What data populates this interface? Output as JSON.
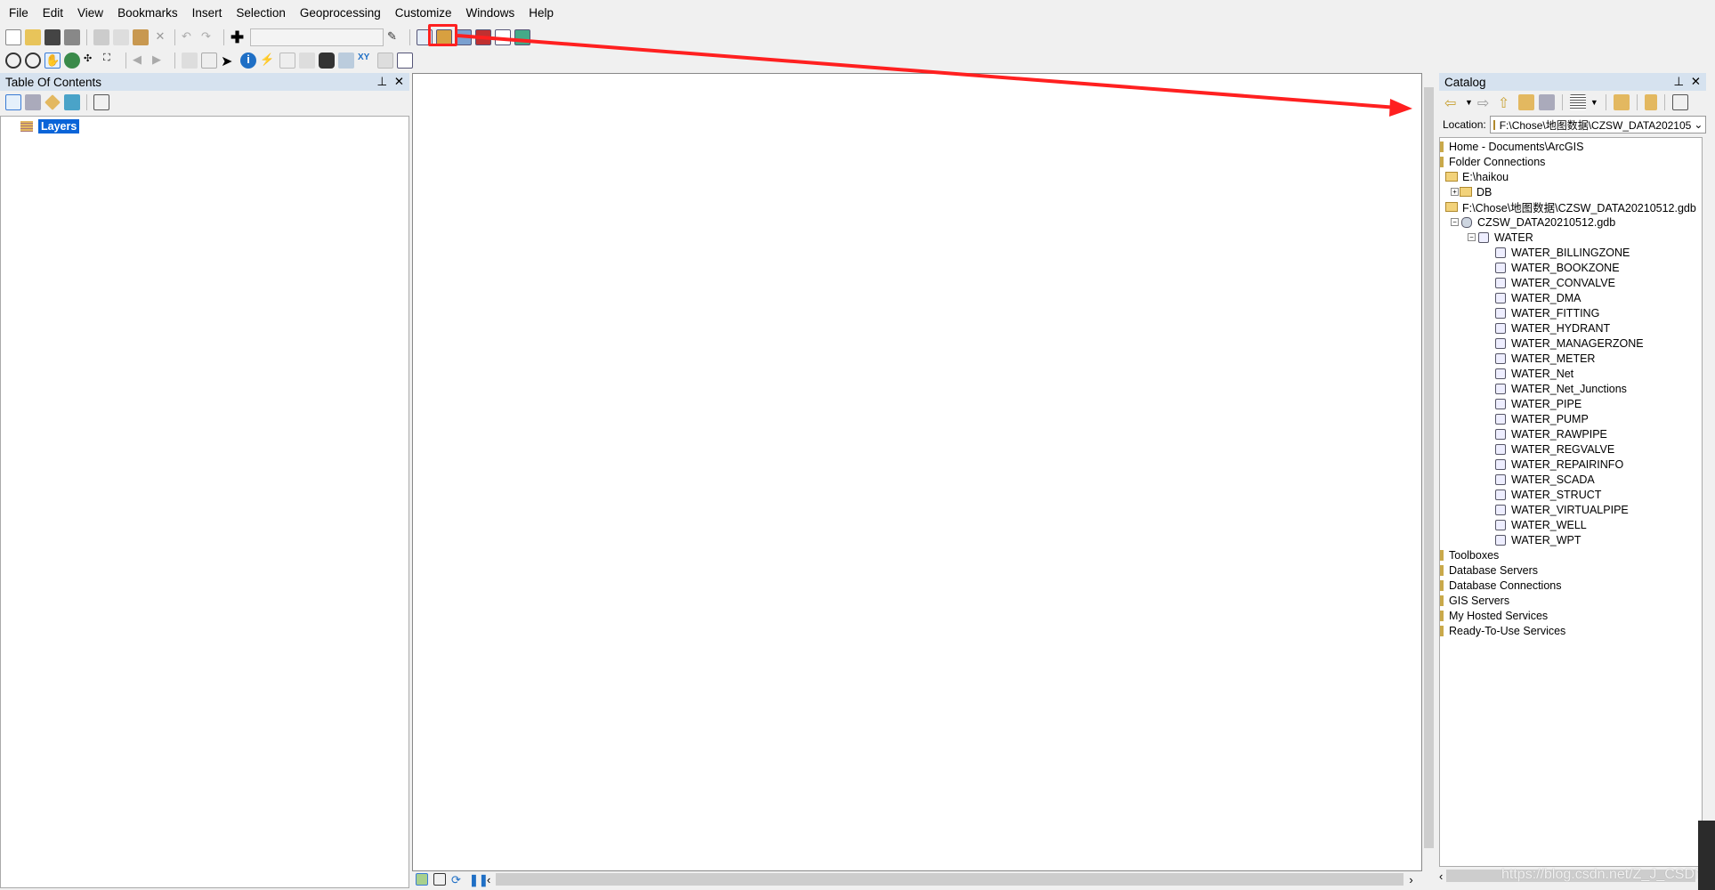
{
  "menu": [
    "File",
    "Edit",
    "View",
    "Bookmarks",
    "Insert",
    "Selection",
    "Geoprocessing",
    "Customize",
    "Windows",
    "Help"
  ],
  "toc": {
    "title": "Table Of Contents",
    "root": "Layers"
  },
  "catalog": {
    "title": "Catalog",
    "location_label": "Location:",
    "location_value": "F:\\Chose\\地图数据\\CZSW_DATA202105",
    "top": [
      "Home - Documents\\ArcGIS",
      "Folder Connections"
    ],
    "haikou": "E:\\haikou",
    "db": "DB",
    "fpath": "F:\\Chose\\地图数据\\CZSW_DATA20210512.gdb",
    "gdb": "CZSW_DATA20210512.gdb",
    "dataset": "WATER",
    "features": [
      {
        "name": "WATER_BILLINGZONE",
        "icon": "polygon-feature-class-icon"
      },
      {
        "name": "WATER_BOOKZONE",
        "icon": "polygon-feature-class-icon"
      },
      {
        "name": "WATER_CONVALVE",
        "icon": "point-feature-class-icon"
      },
      {
        "name": "WATER_DMA",
        "icon": "polygon-feature-class-icon"
      },
      {
        "name": "WATER_FITTING",
        "icon": "point-feature-class-icon"
      },
      {
        "name": "WATER_HYDRANT",
        "icon": "point-feature-class-icon"
      },
      {
        "name": "WATER_MANAGERZONE",
        "icon": "polygon-feature-class-icon"
      },
      {
        "name": "WATER_METER",
        "icon": "point-feature-class-icon"
      },
      {
        "name": "WATER_Net",
        "icon": "geometric-network-icon"
      },
      {
        "name": "WATER_Net_Junctions",
        "icon": "point-feature-class-icon"
      },
      {
        "name": "WATER_PIPE",
        "icon": "line-feature-class-icon"
      },
      {
        "name": "WATER_PUMP",
        "icon": "point-feature-class-icon"
      },
      {
        "name": "WATER_RAWPIPE",
        "icon": "line-feature-class-icon"
      },
      {
        "name": "WATER_REGVALVE",
        "icon": "point-feature-class-icon"
      },
      {
        "name": "WATER_REPAIRINFO",
        "icon": "point-feature-class-icon"
      },
      {
        "name": "WATER_SCADA",
        "icon": "point-feature-class-icon"
      },
      {
        "name": "WATER_STRUCT",
        "icon": "point-feature-class-icon"
      },
      {
        "name": "WATER_VIRTUALPIPE",
        "icon": "line-feature-class-icon"
      },
      {
        "name": "WATER_WELL",
        "icon": "point-feature-class-icon"
      },
      {
        "name": "WATER_WPT",
        "icon": "point-feature-class-icon"
      }
    ],
    "bottom": [
      "Toolboxes",
      "Database Servers",
      "Database Connections",
      "GIS Servers",
      "My Hosted Services",
      "Ready-To-Use Services"
    ]
  },
  "watermark": "https://blog.csdn.net/Z_J_CSDN",
  "colors": {
    "annotation": "#ff2020",
    "selection": "#0a64d8",
    "panel_header": "#d6e2ef"
  }
}
